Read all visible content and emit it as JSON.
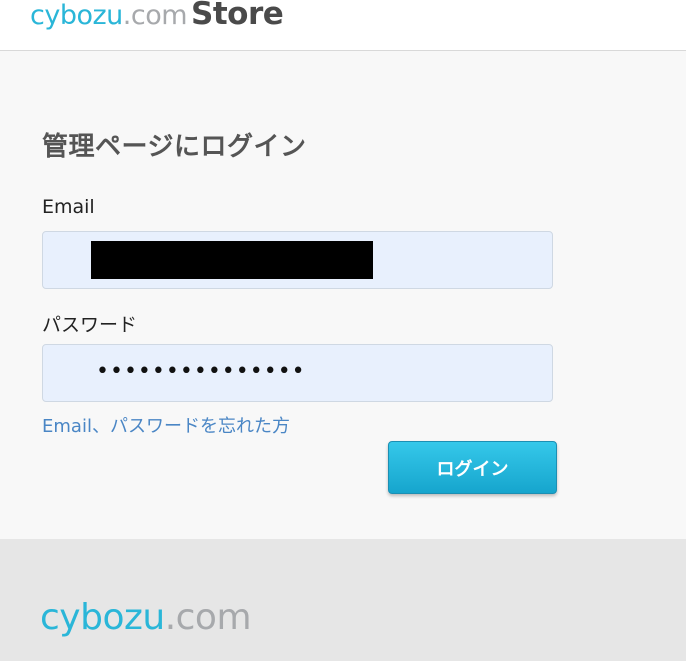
{
  "header": {
    "logo": {
      "brand": "cybozu",
      "tld": ".com",
      "store": "Store"
    }
  },
  "login": {
    "title": "管理ページにログイン",
    "email_label": "Email",
    "email_value": "",
    "password_label": "パスワード",
    "password_value": "•••••••••••••••",
    "forgot_link": "Email、パスワードを忘れた方",
    "submit_label": "ログイン"
  },
  "footer": {
    "logo": {
      "brand": "cybozu",
      "tld": ".com"
    }
  },
  "colors": {
    "brand_cyan": "#2ab6d8",
    "logo_gray": "#a7a9ac",
    "link_blue": "#4a86c5",
    "button_top": "#35c8ea",
    "button_bottom": "#16a5cd",
    "input_bg": "#e8f0fd"
  }
}
